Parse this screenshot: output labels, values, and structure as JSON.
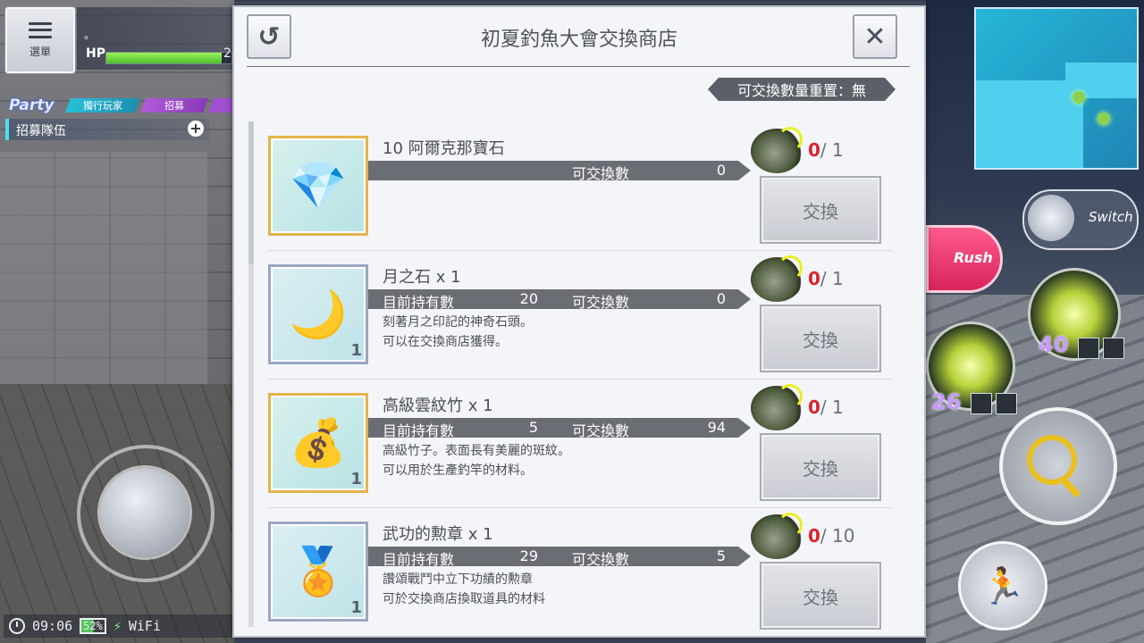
{
  "hud": {
    "menu_label": "選單",
    "player_name": "。",
    "hp_label": "HP",
    "hp_value": "2",
    "hp_fraction": 0.92,
    "party_label": "Party",
    "party_tabs": [
      "獨行玩家",
      "招募"
    ],
    "recruit_label": "招募隊伍",
    "time": "09:06",
    "battery": "52%",
    "network": "WiFi",
    "switch_label": "Switch",
    "rush_label": "Rush",
    "skill_counts": [
      "40",
      "26"
    ]
  },
  "shop": {
    "title": "初夏釣魚大會交換商店",
    "reset_text": "可交換數量重置：無",
    "own_label": "目前持有數",
    "exchangeable_label": "可交換數",
    "exchange_button": "交換",
    "items": [
      {
        "name": "10 阿爾克那寶石",
        "owned": "",
        "exchangeable": "0",
        "desc1": "",
        "desc2": "",
        "qty_badge": "",
        "current": "0",
        "limit": "1",
        "icon": "crystal-icon"
      },
      {
        "name": "月之石 x 1",
        "owned": "20",
        "exchangeable": "0",
        "desc1": "刻著月之印記的神奇石頭。",
        "desc2": "可以在交換商店獲得。",
        "qty_badge": "1",
        "current": "0",
        "limit": "1",
        "icon": "moon-stone-icon"
      },
      {
        "name": "高級雲紋竹 x 1",
        "owned": "5",
        "exchangeable": "94",
        "desc1": "高級竹子。表面長有美麗的斑紋。",
        "desc2": "可以用於生產釣竿的材料。",
        "qty_badge": "1",
        "current": "0",
        "limit": "1",
        "icon": "bag-icon"
      },
      {
        "name": "武功的勲章 x 1",
        "owned": "29",
        "exchangeable": "5",
        "desc1": "讚頌戰鬥中立下功績的勲章",
        "desc2": "可於交換商店換取道具的材料",
        "qty_badge": "1",
        "current": "0",
        "limit": "10",
        "icon": "medal-icon"
      }
    ]
  }
}
